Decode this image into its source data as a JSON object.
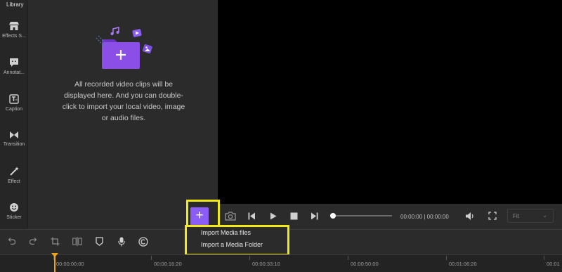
{
  "library": {
    "title": "Library",
    "empty_message": "All recorded video clips will be displayed here. And you can double-click to import your local video, image or audio files."
  },
  "sidebar": {
    "items": [
      {
        "label": "Effects S...",
        "icon": "store-icon"
      },
      {
        "label": "Annotat...",
        "icon": "speech-bubble-icon"
      },
      {
        "label": "Caption",
        "icon": "text-caption-icon"
      },
      {
        "label": "Transition",
        "icon": "bowtie-transition-icon"
      },
      {
        "label": "Effect",
        "icon": "magic-wand-icon"
      },
      {
        "label": "Sticker",
        "icon": "smiley-sticker-icon"
      }
    ]
  },
  "player": {
    "current_time": "00:00:00",
    "total_time": "00:00:00",
    "separator": " | ",
    "fit_label": "Fit",
    "progress": 0
  },
  "add_menu": {
    "button_label": "+",
    "items": [
      "Import Media files",
      "Import a Media Folder"
    ]
  },
  "timeline": {
    "ticks": [
      "00:00:00:00",
      "00:00:16:20",
      "00:00:33:10",
      "00:00:50:00",
      "00:01:06:20",
      "00:01"
    ]
  },
  "colors": {
    "accent": "#8b5cf6",
    "highlight": "#f2ea17",
    "playhead": "#f0a315",
    "panel": "#2b2b2b"
  }
}
